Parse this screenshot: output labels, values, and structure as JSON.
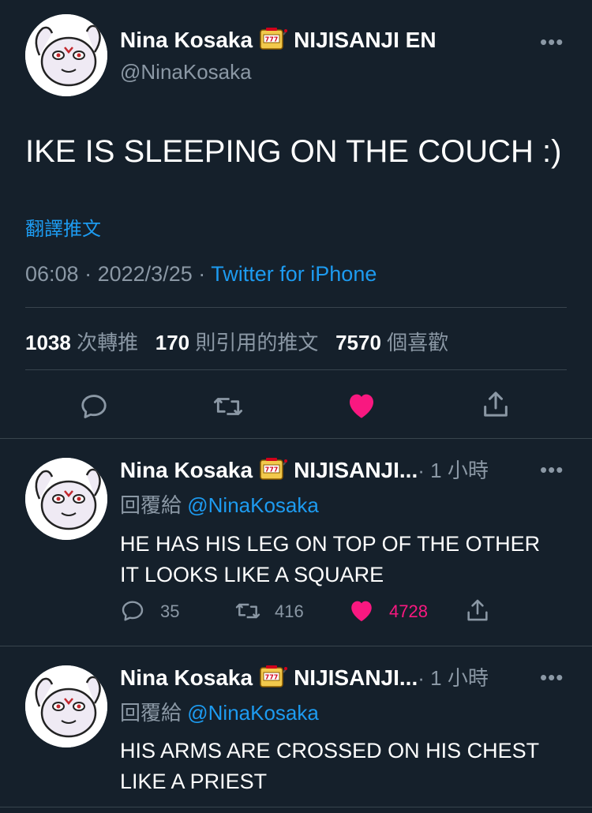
{
  "main_tweet": {
    "author_name": "Nina Kosaka",
    "author_suffix": "NIJISANJI EN",
    "handle": "@NinaKosaka",
    "text": "IKE IS SLEEPING ON THE COUCH :)",
    "translate_label": "翻譯推文",
    "time": "06:08",
    "date": "2022/3/25",
    "sep": "·",
    "source": "Twitter for iPhone",
    "stats": {
      "retweets": "1038",
      "retweets_label": "次轉推",
      "quotes": "170",
      "quotes_label": "則引用的推文",
      "likes": "7570",
      "likes_label": "個喜歡"
    }
  },
  "replies": [
    {
      "author_name": "Nina Kosaka",
      "author_suffix": "NIJISANJI...",
      "time_ago": "· 1 小時",
      "reply_to_label": "回覆給",
      "reply_to_handle": "@NinaKosaka",
      "line1": "HE HAS HIS LEG ON TOP OF THE OTHER",
      "line2": "IT LOOKS LIKE A SQUARE",
      "reply_count": "35",
      "retweet_count": "416",
      "like_count": "4728"
    },
    {
      "author_name": "Nina Kosaka",
      "author_suffix": "NIJISANJI...",
      "time_ago": "· 1 小時",
      "reply_to_label": "回覆給",
      "reply_to_handle": "@NinaKosaka",
      "line1": "HIS ARMS ARE CROSSED ON HIS CHEST",
      "line2": "LIKE A PRIEST"
    }
  ],
  "more_label": "•••",
  "colors": {
    "background": "#15202b",
    "link": "#1d9bf0",
    "like": "#f91880",
    "muted": "#8b98a5",
    "divider": "#38444d"
  },
  "icons": [
    "avatar-character",
    "slot-machine-emoji",
    "more-icon",
    "reply-icon",
    "retweet-icon",
    "heart-icon",
    "share-icon"
  ]
}
